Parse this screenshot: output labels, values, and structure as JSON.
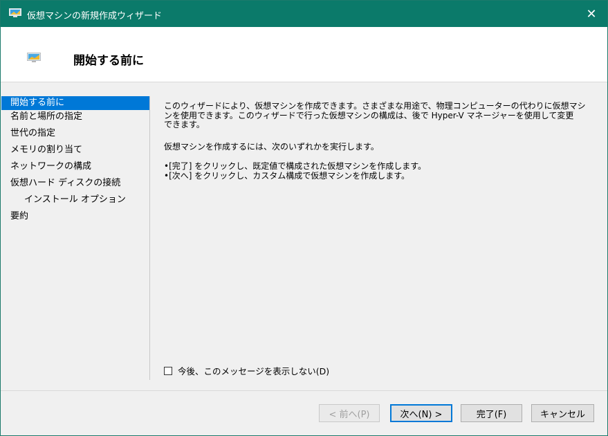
{
  "window": {
    "title": "仮想マシンの新規作成ウィザード"
  },
  "header": {
    "title": "開始する前に"
  },
  "nav": {
    "items": [
      {
        "label": "開始する前に"
      },
      {
        "label": "名前と場所の指定"
      },
      {
        "label": "世代の指定"
      },
      {
        "label": "メモリの割り当て"
      },
      {
        "label": "ネットワークの構成"
      },
      {
        "label": "仮想ハード ディスクの接続"
      },
      {
        "label": "インストール オプション"
      },
      {
        "label": "要約"
      }
    ]
  },
  "content": {
    "paragraph1_line1": "このウィザードにより、仮想マシンを作成できます。さまざまな用途で、物理コンピューターの代わりに仮想マシ",
    "paragraph1_line2": "ンを使用できます。このウィザードで行った仮想マシンの構成は、後で Hyper-V マネージャーを使用して変更",
    "paragraph1_line3": "できます。",
    "paragraph2": "仮想マシンを作成するには、次のいずれかを実行します。",
    "bullet1": "•[完了] をクリックし、既定値で構成された仮想マシンを作成します。",
    "bullet2": "•[次へ] をクリックし、カスタム構成で仮想マシンを作成します。"
  },
  "checkbox": {
    "label": "今後、このメッセージを表示しない(D)",
    "checked": false
  },
  "buttons": {
    "prev": "< 前へ(P)",
    "next": "次へ(N) >",
    "finish": "完了(F)",
    "cancel": "キャンセル"
  },
  "colors": {
    "titlebar": "#0b7a6a",
    "selection": "#0078d7"
  },
  "icons": {
    "window": "monitor-icon",
    "header": "monitor-icon",
    "close": "close-icon"
  }
}
